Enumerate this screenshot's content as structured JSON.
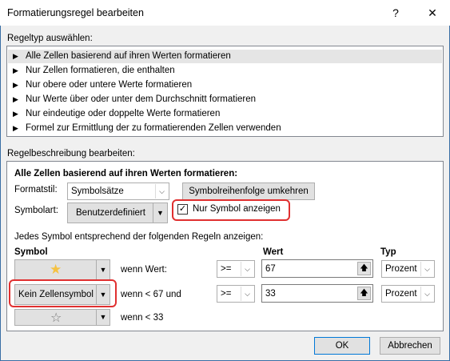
{
  "window": {
    "title": "Formatierungsregel bearbeiten",
    "help_label": "?",
    "close_label": "✕"
  },
  "rule_type": {
    "heading": "Regeltyp auswählen:",
    "items": [
      {
        "label": "Alle Zellen basierend auf ihren Werten formatieren",
        "selected": true
      },
      {
        "label": "Nur Zellen formatieren, die enthalten",
        "selected": false
      },
      {
        "label": "Nur obere oder untere Werte formatieren",
        "selected": false
      },
      {
        "label": "Nur Werte über oder unter dem Durchschnitt formatieren",
        "selected": false
      },
      {
        "label": "Nur eindeutige oder doppelte Werte formatieren",
        "selected": false
      },
      {
        "label": "Formel zur Ermittlung der zu formatierenden Zellen verwenden",
        "selected": false
      }
    ]
  },
  "rule_description": {
    "heading": "Regelbeschreibung bearbeiten:",
    "subheading": "Alle Zellen basierend auf ihren Werten formatieren:",
    "format_style_label": "Formatstil:",
    "format_style_value": "Symbolsätze",
    "reverse_button": "Symbolreihenfolge umkehren",
    "icon_style_label": "Symbolart:",
    "icon_style_value": "Benutzerdefiniert",
    "only_icon_label": "Nur Symbol anzeigen",
    "only_icon_checked": true,
    "rules_intro": "Jedes Symbol entsprechend der folgenden Regeln anzeigen:",
    "col_symbol": "Symbol",
    "col_value": "Wert",
    "col_type": "Typ",
    "rows": [
      {
        "icon": "gold-star",
        "symbol_text": "",
        "condition": "wenn Wert:",
        "operator": ">=",
        "value": "67",
        "type": "Prozent"
      },
      {
        "icon": "none",
        "symbol_text": "Kein Zellensymbol",
        "condition": "wenn < 67 und",
        "operator": ">=",
        "value": "33",
        "type": "Prozent"
      },
      {
        "icon": "empty-star",
        "symbol_text": "",
        "condition": "wenn < 33"
      }
    ]
  },
  "buttons": {
    "ok": "OK",
    "cancel": "Abbrechen"
  },
  "colors": {
    "highlight": "#e03030",
    "star": "#f5c242"
  }
}
